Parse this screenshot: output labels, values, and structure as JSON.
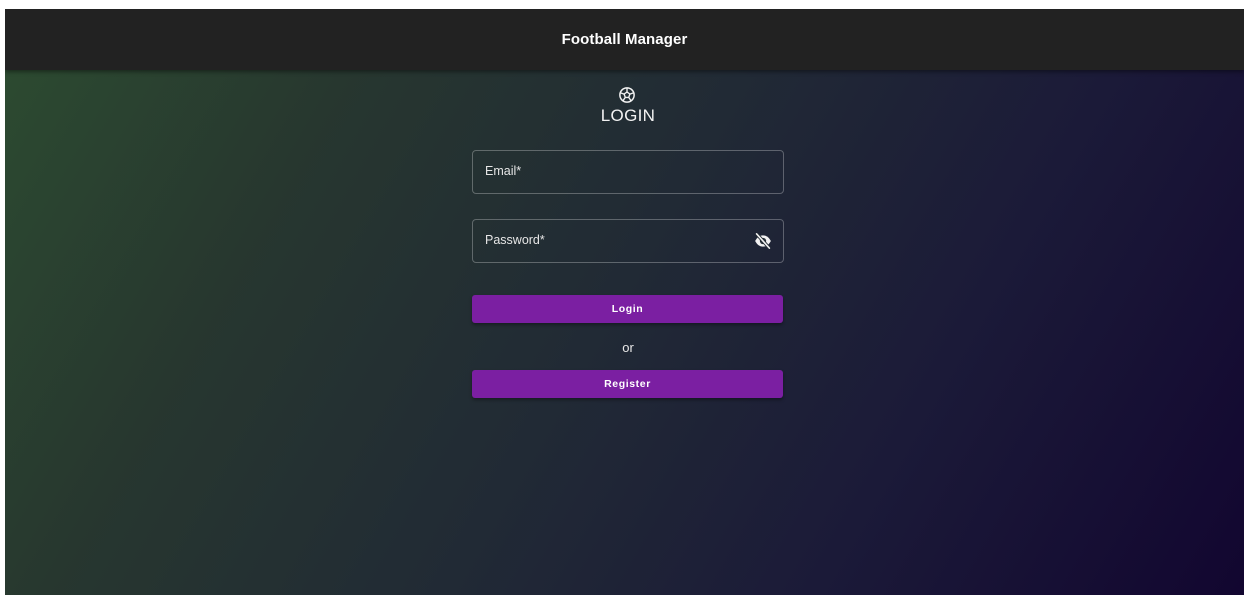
{
  "app": {
    "title": "Football Manager"
  },
  "login": {
    "icon": "football-icon",
    "heading": "LOGIN",
    "email": {
      "label": "Email*",
      "value": ""
    },
    "password": {
      "label": "Password*",
      "value": "",
      "toggle_icon": "eye-off-icon"
    },
    "login_button": "Login",
    "separator": "or",
    "register_button": "Register"
  },
  "colors": {
    "appbar": "#222222",
    "button": "#7b1fa2",
    "gradient_start": "#2c4a30",
    "gradient_end": "#120630"
  }
}
